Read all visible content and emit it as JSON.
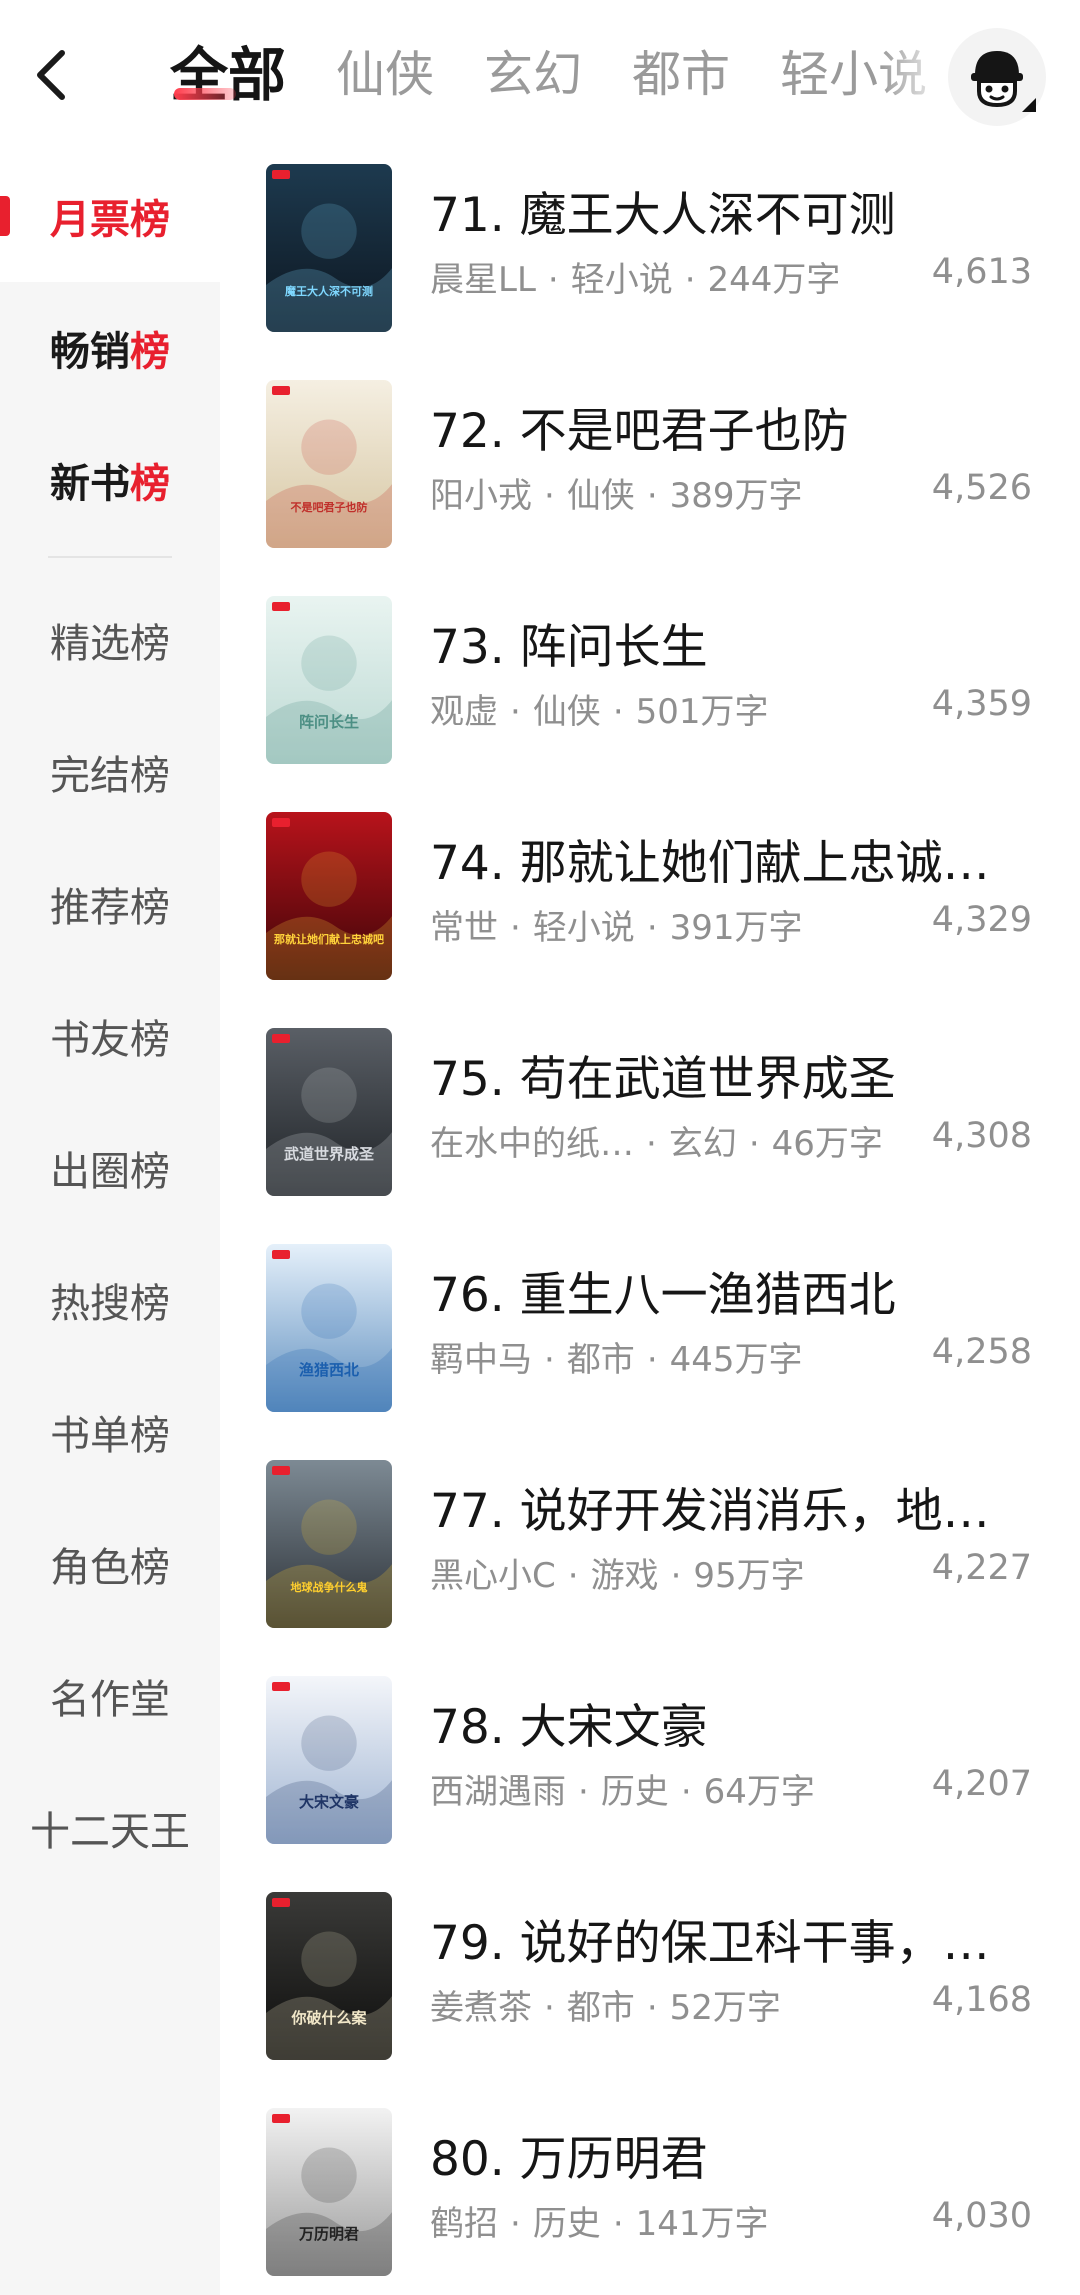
{
  "header": {
    "tabs": [
      {
        "label": "全部",
        "active": true
      },
      {
        "label": "仙侠",
        "active": false
      },
      {
        "label": "玄幻",
        "active": false
      },
      {
        "label": "都市",
        "active": false
      },
      {
        "label": "轻小说",
        "active": false
      }
    ],
    "back_icon": "chevron-left-icon",
    "avatar_icon": "user-avatar-icon"
  },
  "sidebar": {
    "items": [
      {
        "label": "月票榜",
        "active": true
      },
      {
        "label": "畅销榜",
        "label_main": "畅销",
        "label_accent": "榜"
      },
      {
        "label": "新书榜",
        "label_main": "新书",
        "label_accent": "榜"
      },
      {
        "label": "精选榜"
      },
      {
        "label": "完结榜"
      },
      {
        "label": "推荐榜"
      },
      {
        "label": "书友榜"
      },
      {
        "label": "出圈榜"
      },
      {
        "label": "热搜榜"
      },
      {
        "label": "书单榜"
      },
      {
        "label": "角色榜"
      },
      {
        "label": "名作堂"
      },
      {
        "label": "十二天王"
      }
    ]
  },
  "books": [
    {
      "rank": "71",
      "title": "71. 魔王大人深不可测",
      "author": "晨星LL",
      "genre": "轻小说",
      "words": "244万字",
      "count": "4,613"
    },
    {
      "rank": "72",
      "title": "72. 不是吧君子也防",
      "author": "阳小戎",
      "genre": "仙侠",
      "words": "389万字",
      "count": "4,526"
    },
    {
      "rank": "73",
      "title": "73. 阵问长生",
      "author": "观虚",
      "genre": "仙侠",
      "words": "501万字",
      "count": "4,359"
    },
    {
      "rank": "74",
      "title": "74. 那就让她们献上忠诚…",
      "author": "常世",
      "genre": "轻小说",
      "words": "391万字",
      "count": "4,329"
    },
    {
      "rank": "75",
      "title": "75. 苟在武道世界成圣",
      "author": "在水中的纸…",
      "genre": "玄幻",
      "words": "46万字",
      "count": "4,308"
    },
    {
      "rank": "76",
      "title": "76. 重生八一渔猎西北",
      "author": "羁中马",
      "genre": "都市",
      "words": "445万字",
      "count": "4,258"
    },
    {
      "rank": "77",
      "title": "77. 说好开发消消乐，地…",
      "author": "黑心小C",
      "genre": "游戏",
      "words": "95万字",
      "count": "4,227"
    },
    {
      "rank": "78",
      "title": "78. 大宋文豪",
      "author": "西湖遇雨",
      "genre": "历史",
      "words": "64万字",
      "count": "4,207"
    },
    {
      "rank": "79",
      "title": "79. 说好的保卫科干事，…",
      "author": "姜煮茶",
      "genre": "都市",
      "words": "52万字",
      "count": "4,168"
    },
    {
      "rank": "80",
      "title": "80. 万历明君",
      "author": "鹤招",
      "genre": "历史",
      "words": "141万字",
      "count": "4,030"
    }
  ],
  "covers": {
    "71": {
      "bg1": "#1d3a4f",
      "bg2": "#0d1620",
      "accent": "#7fd8ff",
      "text": "魔王大人深不可测"
    },
    "72": {
      "bg1": "#f5efe2",
      "bg2": "#d6c6a2",
      "accent": "#c0302b",
      "text": "不是吧君子也防"
    },
    "73": {
      "bg1": "#e9f4f1",
      "bg2": "#bcd9d3",
      "accent": "#4c8f84",
      "text": "阵问长生"
    },
    "74": {
      "bg1": "#b8131b",
      "bg2": "#3c0508",
      "accent": "#ffd23a",
      "text": "那就让她们献上忠诚吧"
    },
    "75": {
      "bg1": "#5a5f66",
      "bg2": "#1f2327",
      "accent": "#d8dbe0",
      "text": "武道世界成圣"
    },
    "76": {
      "bg1": "#e5f0fa",
      "bg2": "#5f8fbf",
      "accent": "#1b5fae",
      "text": "渔猎西北"
    },
    "77": {
      "bg1": "#7d8a94",
      "bg2": "#2b3036",
      "accent": "#ffcf2e",
      "text": "地球战争什么鬼"
    },
    "78": {
      "bg1": "#f4f6fa",
      "bg2": "#9fb4d2",
      "accent": "#1f3566",
      "text": "大宋文豪"
    },
    "79": {
      "bg1": "#3a3a38",
      "bg2": "#0d0d0c",
      "accent": "#f1e7c8",
      "text": "你破什么案"
    },
    "80": {
      "bg1": "#f2f2f2",
      "bg2": "#9a9a9a",
      "accent": "#222222",
      "text": "万历明君"
    }
  }
}
